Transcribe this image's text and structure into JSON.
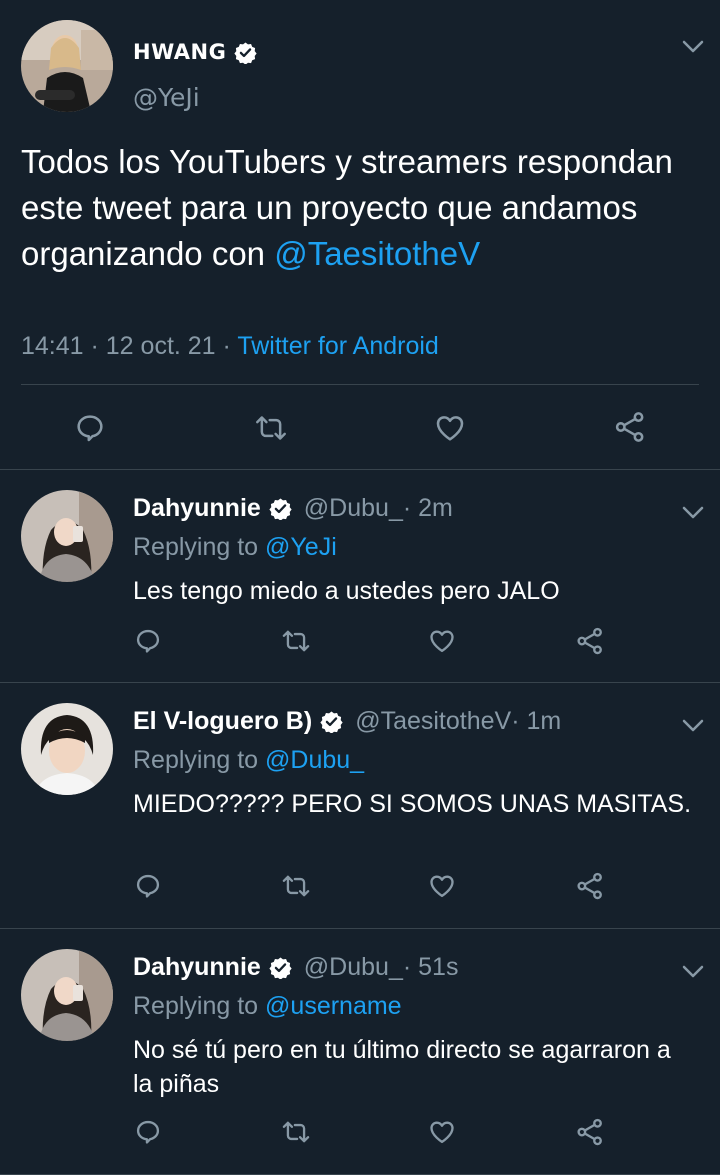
{
  "main_tweet": {
    "name": "HWANG",
    "handle": "@YeJi",
    "text_plain": "Todos los YouTubers y streamers respondan este tweet para un proyecto que andamos organizando con ",
    "text_mention": "@TaesitotheV",
    "time": "14:41",
    "date": "12 oct. 21",
    "source": "Twitter for Android",
    "separator": " · "
  },
  "replies": [
    {
      "name": "Dahyunnie",
      "handle": "@Dubu_",
      "time": " · 2m",
      "replying_label": "Replying to ",
      "replying_to": "@YeJi",
      "text": "Les tengo miedo a ustedes pero JALO"
    },
    {
      "name": "El V-loguero B)",
      "handle": "@TaesitotheV",
      "time": " · 1m",
      "replying_label": "Replying to ",
      "replying_to": "@Dubu_",
      "text": "MIEDO????? PERO SI SOMOS UNAS MASITAS."
    },
    {
      "name": "Dahyunnie",
      "handle": "@Dubu_",
      "time": " · 51s",
      "replying_label": "Replying to ",
      "replying_to": "@username",
      "text": "No sé tú pero en tu último directo se agarraron a la piñas"
    }
  ],
  "icons": {
    "reply": "speech-bubble-icon",
    "retweet": "retweet-icon",
    "like": "heart-icon",
    "share": "share-icon",
    "verified": "verified-badge-icon",
    "menu": "chevron-down-icon"
  },
  "colors": {
    "background": "#15202b",
    "link": "#1da1f2",
    "secondary_text": "#8899a6",
    "divider": "#38444d",
    "icon": "#8899a6"
  }
}
